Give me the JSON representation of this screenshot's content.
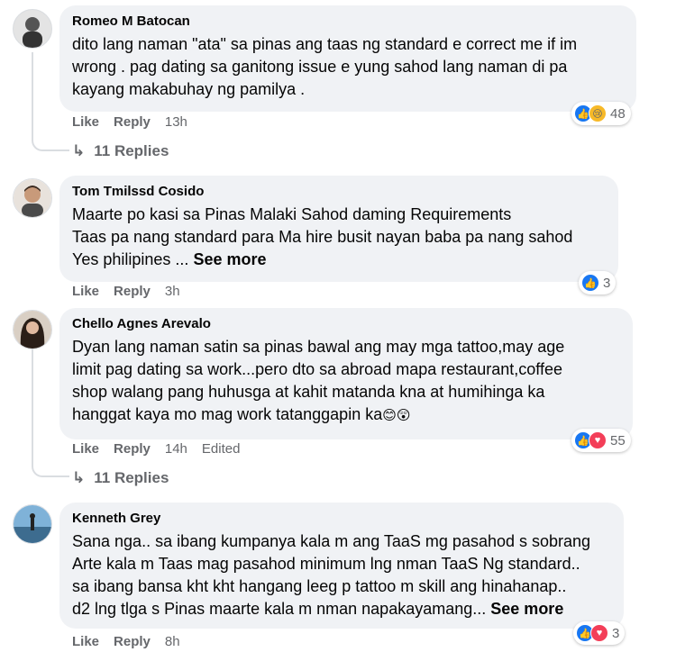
{
  "comments": [
    {
      "author": "Romeo M Batocan",
      "lines": [
        "dito lang naman \"ata\" sa pinas ang taas ng standard e correct me if im",
        "wrong . pag dating sa ganitong issue e yung sahod lang naman di pa",
        "kayang makabuhay ng pamilya ."
      ],
      "like": "Like",
      "reply": "Reply",
      "time": "13h",
      "reaction_count": "48",
      "replies": "11 Replies",
      "reactions": [
        "like-icon",
        "sad-icon"
      ]
    },
    {
      "author": "Tom Tmilssd Cosido",
      "lines": [
        "Maarte po kasi sa Pinas Malaki Sahod daming Requirements",
        "Taas pa nang standard para Ma hire busit nayan baba pa nang sahod",
        "Yes philipines ..."
      ],
      "see_more": "See more",
      "like": "Like",
      "reply": "Reply",
      "time": "3h",
      "reaction_count": "3",
      "reactions": [
        "like-icon"
      ]
    },
    {
      "author": "Chello Agnes Arevalo",
      "lines": [
        "Dyan lang naman satin sa pinas bawal ang may mga tattoo,may age",
        "limit pag dating sa work...pero dto sa abroad mapa restaurant,coffee",
        "shop walang pang huhusga at kahit matanda kna at humihinga ka",
        "hanggat kaya mo mag work tatanggapin ka"
      ],
      "emojis": "😊😲",
      "like": "Like",
      "reply": "Reply",
      "time": "14h",
      "edited": "Edited",
      "reaction_count": "55",
      "replies": "11 Replies",
      "reactions": [
        "like-icon",
        "love-icon"
      ]
    },
    {
      "author": "Kenneth Grey",
      "lines": [
        "Sana nga.. sa ibang kumpanya kala m ang TaaS mg pasahod s sobrang",
        "Arte kala m Taas mag pasahod minimum lng nman TaaS Ng standard..",
        "sa ibang bansa kht kht hangang leeg p tattoo m skill ang hinahanap..",
        "d2 lng tlga s Pinas maarte kala m nman napakayamang..."
      ],
      "see_more": "See more",
      "like": "Like",
      "reply": "Reply",
      "time": "8h",
      "reaction_count": "3",
      "reactions": [
        "like-icon",
        "love-icon"
      ]
    }
  ],
  "colors": {
    "bubble": "#f0f2f5",
    "meta": "#65676b",
    "like_blue": "#1877f2",
    "love_red": "#f33e58",
    "sad_yellow": "#f7b928"
  }
}
